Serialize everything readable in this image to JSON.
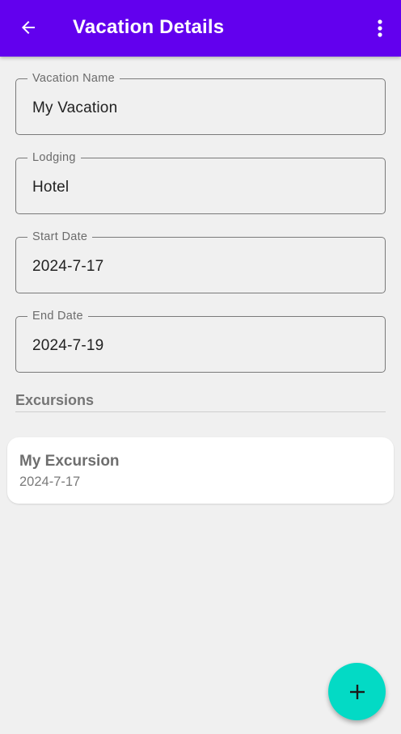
{
  "app_bar": {
    "title": "Vacation Details",
    "back_icon": "arrow-left-icon",
    "menu_icon": "more-vertical-icon",
    "color": "#6200ee"
  },
  "fields": [
    {
      "label": "Vacation Name",
      "value": "My Vacation"
    },
    {
      "label": "Lodging",
      "value": "Hotel"
    },
    {
      "label": "Start Date",
      "value": "2024-7-17"
    },
    {
      "label": "End Date",
      "value": "2024-7-19"
    }
  ],
  "excursions": {
    "heading": "Excursions",
    "items": [
      {
        "title": "My Excursion",
        "date": "2024-7-17"
      }
    ]
  },
  "fab": {
    "icon": "plus-icon",
    "color": "#03dac5"
  }
}
